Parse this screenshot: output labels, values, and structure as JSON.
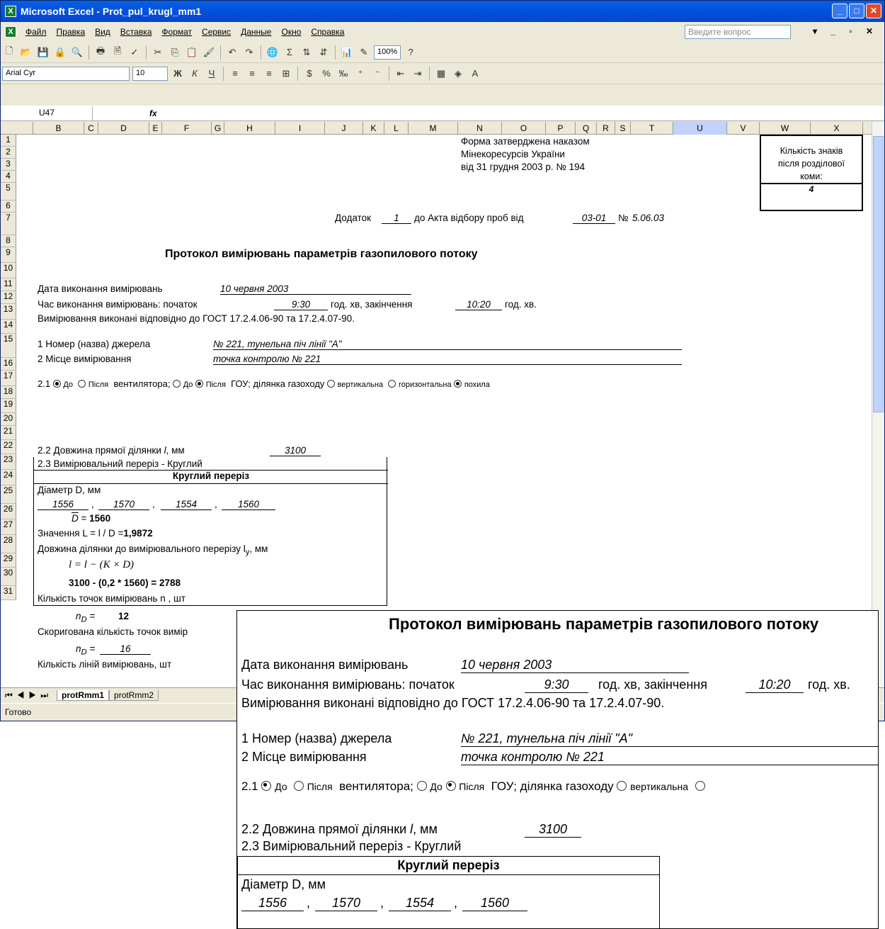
{
  "window": {
    "title": "Microsoft Excel - Prot_pul_krugl_mm1"
  },
  "menu": {
    "items": [
      "Файл",
      "Правка",
      "Вид",
      "Вставка",
      "Формат",
      "Сервис",
      "Данные",
      "Окно",
      "Справка"
    ],
    "ask": "Введите вопрос"
  },
  "toolbar": {
    "zoom": "100%",
    "font": "Arial Cyr",
    "size": "10"
  },
  "formula": {
    "cell": "U47",
    "fx": "fx"
  },
  "columns": [
    "B",
    "C",
    "D",
    "E",
    "F",
    "G",
    "H",
    "I",
    "J",
    "K",
    "L",
    "M",
    "N",
    "O",
    "P",
    "Q",
    "R",
    "S",
    "T",
    "U",
    "V",
    "W",
    "X"
  ],
  "rows": [
    "1",
    "2",
    "3",
    "4",
    "5",
    "6",
    "7",
    "8",
    "9",
    "10",
    "11",
    "12",
    "13",
    "14",
    "15",
    "16",
    "17",
    "18",
    "19",
    "20",
    "21",
    "22",
    "23",
    "24",
    "25",
    "26",
    "27",
    "28",
    "29",
    "30",
    "31"
  ],
  "sheet": {
    "form1": "Форма затверджена наказом",
    "form2": "Мінекоресурсів України",
    "form3": "від 31 грудня 2003 р. № 194",
    "box1": "Кількість знаків",
    "box2": "після розділової",
    "box3": "коми:",
    "box_val": "4",
    "addendum": "Додаток",
    "add_num": "1",
    "add_text": "до Акта відбору проб від",
    "add_date": "03-01",
    "add_no": "№",
    "add_no_val": "5.06.03",
    "title": "Протокол вимірювань параметрів газопилового потоку",
    "date_label": "Дата виконання вимірювань",
    "date_val": "10 червня 2003",
    "time_label": "Час виконання вимірювань: початок",
    "time_start": "9:30",
    "time_mid": "год. хв, закінчення",
    "time_end": "10:20",
    "time_unit": "год. хв.",
    "gost": "Вимірювання виконані відповідно до ГОСТ 17.2.4.06-90 та 17.2.4.07-90.",
    "src_label": "1 Номер (назва) джерела",
    "src_val": "№ 221, тунельна піч лінії \"А\"",
    "place_label": "2 Місце вимірювання",
    "place_val": "точка контролю № 221",
    "r21": "2.1",
    "r_do": "До",
    "r_after": "Після",
    "r_fan": "вентилятора;",
    "r_gou": "ГОУ; ділянка газоходу",
    "r_vert": "вертикальна",
    "r_hor": "горизонтальна",
    "r_incl": "похила",
    "len_label": "2.2 Довжина прямої ділянки",
    "len_l": "l",
    "len_unit": ", мм",
    "len_val": "3100",
    "sect": "2.3 Вимірювальний переріз - Круглий",
    "round": "Круглий переріз",
    "diam": "Діаметр D, мм",
    "d1": "1556",
    "d2": "1570",
    "d3": "1554",
    "d4": "1560",
    "dbar": "D",
    "dbar_eq": " = ",
    "dbar_val": "1560",
    "lval": "Значення L = l / D =",
    "lval_v": "1,9872",
    "ly": "Довжина ділянки до вимірювального перерізу l",
    "ly_sub": "y",
    "ly_unit": ",  мм",
    "ly_formula": "l = l − (K × D)",
    "ly_calc": "3100 - (0,2 * 1560) = 2788",
    "points": "Кількість точок вимірювань n",
    "points_unit": ", шт",
    "nd_val": "12",
    "corr": "Скоригована кількість точок вимір",
    "nd2_val": "16",
    "lines": "Кількість ліній вимірювань, шт"
  },
  "tabs": [
    "protRmm1",
    "protRmm2"
  ],
  "status": "Готово"
}
